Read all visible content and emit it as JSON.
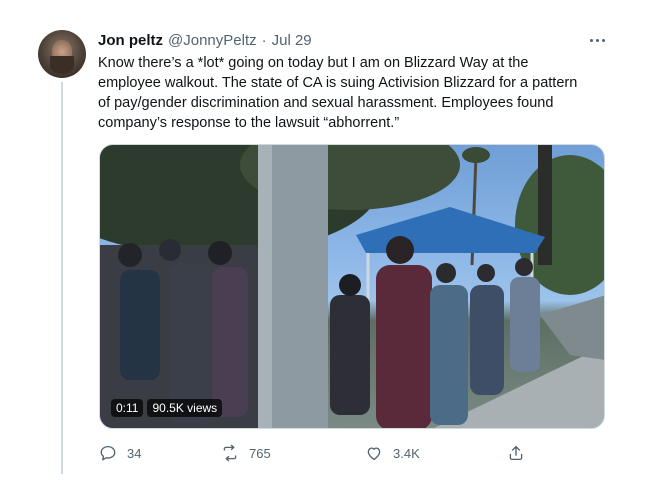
{
  "author": {
    "name": "Jon peltz",
    "handle": "@JonnyPeltz",
    "separator": "·",
    "date": "Jul 29"
  },
  "tweet_text": "Know there’s a *lot* going on today but I am on Blizzard Way at the\nemployee walkout. The state of CA is suing Activision Blizzard for a pattern\nof pay/gender discrimination and sexual harassment. Employees found\ncompany’s response to the lawsuit “abhorrent.”",
  "video": {
    "duration": "0:11",
    "views": "90.5K views"
  },
  "actions": {
    "replies": "34",
    "retweets": "765",
    "likes": "3.4K"
  },
  "icons": {
    "more": "more-dots-icon",
    "reply": "reply-icon",
    "retweet": "retweet-icon",
    "like": "heart-icon",
    "share": "share-icon"
  },
  "colors": {
    "text_primary": "#0f1419",
    "text_secondary": "#536471",
    "border": "#cfd9de"
  }
}
